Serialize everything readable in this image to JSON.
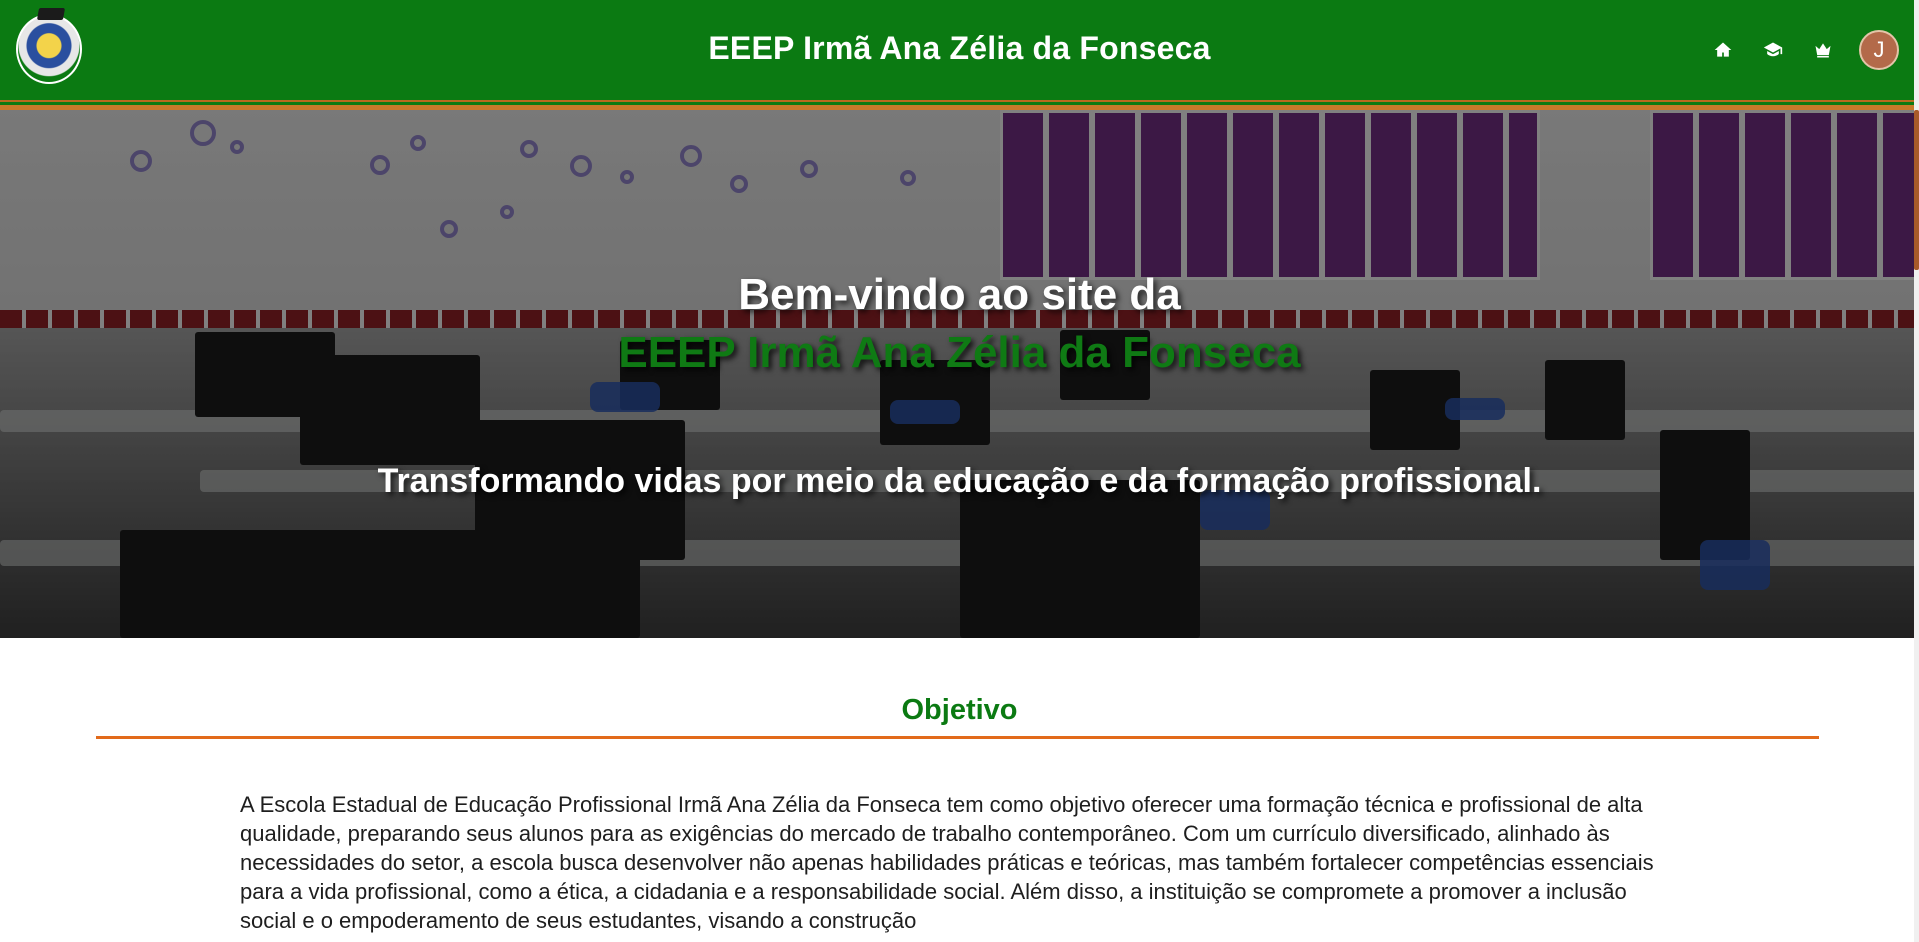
{
  "header": {
    "title": "EEEP Irmã Ana Zélia da Fonseca",
    "avatar_initial": "J",
    "nav": [
      {
        "name": "home-icon"
      },
      {
        "name": "graduation-cap-icon"
      },
      {
        "name": "crown-icon"
      }
    ],
    "colors": {
      "bar": "#0b7a12",
      "border": "#c77a2a"
    }
  },
  "hero": {
    "welcome": "Bem-vindo ao site da",
    "school": "EEEP Irmã Ana Zélia da Fonseca",
    "slogan": "Transformando vidas por meio da educação e da formação profissional."
  },
  "objective": {
    "title": "Objetivo",
    "text": "A Escola Estadual de Educação Profissional Irmã Ana Zélia da Fonseca tem como objetivo oferecer uma formação técnica e profissional de alta qualidade, preparando seus alunos para as exigências do mercado de trabalho contemporâneo. Com um currículo diversificado, alinhado às necessidades do setor, a escola busca desenvolver não apenas habilidades práticas e teóricas, mas também fortalecer competências essenciais para a vida profissional, como a ética, a cidadania e a responsabilidade social. Além disso, a instituição se compromete a promover a inclusão social e o empoderamento de seus estudantes, visando a construção"
  }
}
